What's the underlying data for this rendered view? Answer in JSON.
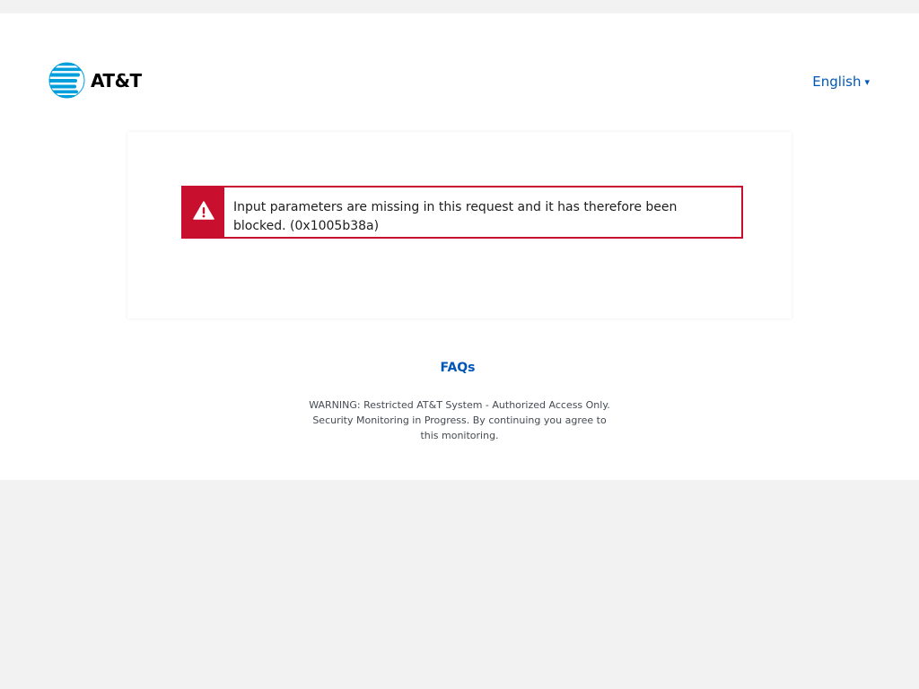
{
  "header": {
    "brand_name": "AT&T",
    "language_label": "English",
    "language_caret": "▾"
  },
  "alert": {
    "message": "Input parameters are missing in this request and it has therefore been blocked. (0x1005b38a)",
    "color": "#c8102e"
  },
  "footer": {
    "faqs_label": "FAQs",
    "warning_text": "WARNING: Restricted AT&T System - Authorized Access Only. Security Monitoring in Progress. By continuing you agree to this monitoring."
  },
  "colors": {
    "brand_blue": "#009fdb",
    "link_blue": "#0057b8",
    "alert_red": "#c8102e",
    "background": "#f2f2f2"
  },
  "icons": {
    "logo": "att-globe-icon",
    "alert": "warning-triangle-icon"
  }
}
